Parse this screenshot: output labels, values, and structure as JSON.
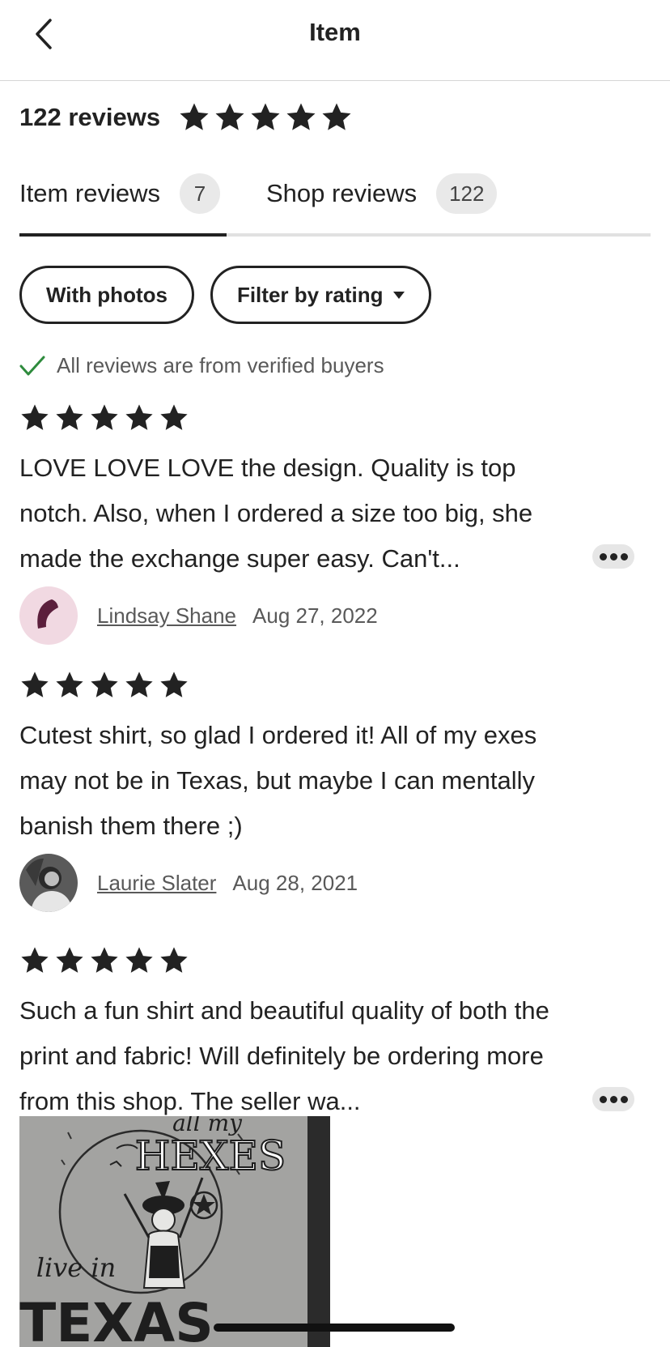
{
  "header": {
    "title": "Item",
    "back_icon": "chevron-left-icon"
  },
  "summary": {
    "count_label": "122 reviews",
    "rating": 5,
    "max_rating": 5
  },
  "tabs": [
    {
      "label": "Item reviews",
      "count": "7",
      "active": true
    },
    {
      "label": "Shop reviews",
      "count": "122",
      "active": false
    }
  ],
  "filters": {
    "with_photos_label": "With photos",
    "filter_rating_label": "Filter by rating",
    "filter_rating_icon": "caret-down-icon"
  },
  "verified": {
    "text": "All reviews are from verified buyers",
    "icon": "check-icon",
    "icon_color": "#2e8b3d"
  },
  "reviews": [
    {
      "rating": 5,
      "text": "LOVE LOVE LOVE the design. Quality is top notch. Also, when I ordered a size too big, she made the exchange super easy. Can't...",
      "truncated": true,
      "author": "Lindsay Shane",
      "date": "Aug 27, 2022"
    },
    {
      "rating": 5,
      "text": "Cutest shirt, so glad I ordered it! All of my exes may not be in Texas, but maybe I can mentally banish them there ;)",
      "truncated": false,
      "author": "Laurie Slater",
      "date": "Aug 28, 2021"
    },
    {
      "rating": 5,
      "text": "Such a fun shirt and beautiful quality of both the print and fabric! Will definitely be ordering more from this shop. The seller wa...",
      "truncated": true
    }
  ],
  "review_photo": {
    "line1": "all my",
    "line2": "HEXES",
    "line3": "live in",
    "line4": "TEXAS"
  },
  "colors": {
    "text": "#222222",
    "muted": "#595959",
    "pill_bg": "#e9e9e9",
    "check": "#2e8b3d"
  }
}
